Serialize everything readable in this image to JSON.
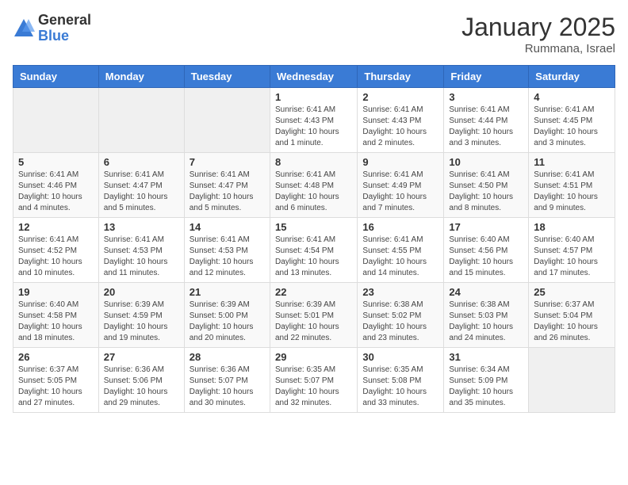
{
  "logo": {
    "general": "General",
    "blue": "Blue"
  },
  "title": "January 2025",
  "location": "Rummana, Israel",
  "days_header": [
    "Sunday",
    "Monday",
    "Tuesday",
    "Wednesday",
    "Thursday",
    "Friday",
    "Saturday"
  ],
  "weeks": [
    [
      {
        "day": "",
        "info": ""
      },
      {
        "day": "",
        "info": ""
      },
      {
        "day": "",
        "info": ""
      },
      {
        "day": "1",
        "info": "Sunrise: 6:41 AM\nSunset: 4:43 PM\nDaylight: 10 hours\nand 1 minute."
      },
      {
        "day": "2",
        "info": "Sunrise: 6:41 AM\nSunset: 4:43 PM\nDaylight: 10 hours\nand 2 minutes."
      },
      {
        "day": "3",
        "info": "Sunrise: 6:41 AM\nSunset: 4:44 PM\nDaylight: 10 hours\nand 3 minutes."
      },
      {
        "day": "4",
        "info": "Sunrise: 6:41 AM\nSunset: 4:45 PM\nDaylight: 10 hours\nand 3 minutes."
      }
    ],
    [
      {
        "day": "5",
        "info": "Sunrise: 6:41 AM\nSunset: 4:46 PM\nDaylight: 10 hours\nand 4 minutes."
      },
      {
        "day": "6",
        "info": "Sunrise: 6:41 AM\nSunset: 4:47 PM\nDaylight: 10 hours\nand 5 minutes."
      },
      {
        "day": "7",
        "info": "Sunrise: 6:41 AM\nSunset: 4:47 PM\nDaylight: 10 hours\nand 5 minutes."
      },
      {
        "day": "8",
        "info": "Sunrise: 6:41 AM\nSunset: 4:48 PM\nDaylight: 10 hours\nand 6 minutes."
      },
      {
        "day": "9",
        "info": "Sunrise: 6:41 AM\nSunset: 4:49 PM\nDaylight: 10 hours\nand 7 minutes."
      },
      {
        "day": "10",
        "info": "Sunrise: 6:41 AM\nSunset: 4:50 PM\nDaylight: 10 hours\nand 8 minutes."
      },
      {
        "day": "11",
        "info": "Sunrise: 6:41 AM\nSunset: 4:51 PM\nDaylight: 10 hours\nand 9 minutes."
      }
    ],
    [
      {
        "day": "12",
        "info": "Sunrise: 6:41 AM\nSunset: 4:52 PM\nDaylight: 10 hours\nand 10 minutes."
      },
      {
        "day": "13",
        "info": "Sunrise: 6:41 AM\nSunset: 4:53 PM\nDaylight: 10 hours\nand 11 minutes."
      },
      {
        "day": "14",
        "info": "Sunrise: 6:41 AM\nSunset: 4:53 PM\nDaylight: 10 hours\nand 12 minutes."
      },
      {
        "day": "15",
        "info": "Sunrise: 6:41 AM\nSunset: 4:54 PM\nDaylight: 10 hours\nand 13 minutes."
      },
      {
        "day": "16",
        "info": "Sunrise: 6:41 AM\nSunset: 4:55 PM\nDaylight: 10 hours\nand 14 minutes."
      },
      {
        "day": "17",
        "info": "Sunrise: 6:40 AM\nSunset: 4:56 PM\nDaylight: 10 hours\nand 15 minutes."
      },
      {
        "day": "18",
        "info": "Sunrise: 6:40 AM\nSunset: 4:57 PM\nDaylight: 10 hours\nand 17 minutes."
      }
    ],
    [
      {
        "day": "19",
        "info": "Sunrise: 6:40 AM\nSunset: 4:58 PM\nDaylight: 10 hours\nand 18 minutes."
      },
      {
        "day": "20",
        "info": "Sunrise: 6:39 AM\nSunset: 4:59 PM\nDaylight: 10 hours\nand 19 minutes."
      },
      {
        "day": "21",
        "info": "Sunrise: 6:39 AM\nSunset: 5:00 PM\nDaylight: 10 hours\nand 20 minutes."
      },
      {
        "day": "22",
        "info": "Sunrise: 6:39 AM\nSunset: 5:01 PM\nDaylight: 10 hours\nand 22 minutes."
      },
      {
        "day": "23",
        "info": "Sunrise: 6:38 AM\nSunset: 5:02 PM\nDaylight: 10 hours\nand 23 minutes."
      },
      {
        "day": "24",
        "info": "Sunrise: 6:38 AM\nSunset: 5:03 PM\nDaylight: 10 hours\nand 24 minutes."
      },
      {
        "day": "25",
        "info": "Sunrise: 6:37 AM\nSunset: 5:04 PM\nDaylight: 10 hours\nand 26 minutes."
      }
    ],
    [
      {
        "day": "26",
        "info": "Sunrise: 6:37 AM\nSunset: 5:05 PM\nDaylight: 10 hours\nand 27 minutes."
      },
      {
        "day": "27",
        "info": "Sunrise: 6:36 AM\nSunset: 5:06 PM\nDaylight: 10 hours\nand 29 minutes."
      },
      {
        "day": "28",
        "info": "Sunrise: 6:36 AM\nSunset: 5:07 PM\nDaylight: 10 hours\nand 30 minutes."
      },
      {
        "day": "29",
        "info": "Sunrise: 6:35 AM\nSunset: 5:07 PM\nDaylight: 10 hours\nand 32 minutes."
      },
      {
        "day": "30",
        "info": "Sunrise: 6:35 AM\nSunset: 5:08 PM\nDaylight: 10 hours\nand 33 minutes."
      },
      {
        "day": "31",
        "info": "Sunrise: 6:34 AM\nSunset: 5:09 PM\nDaylight: 10 hours\nand 35 minutes."
      },
      {
        "day": "",
        "info": ""
      }
    ]
  ]
}
